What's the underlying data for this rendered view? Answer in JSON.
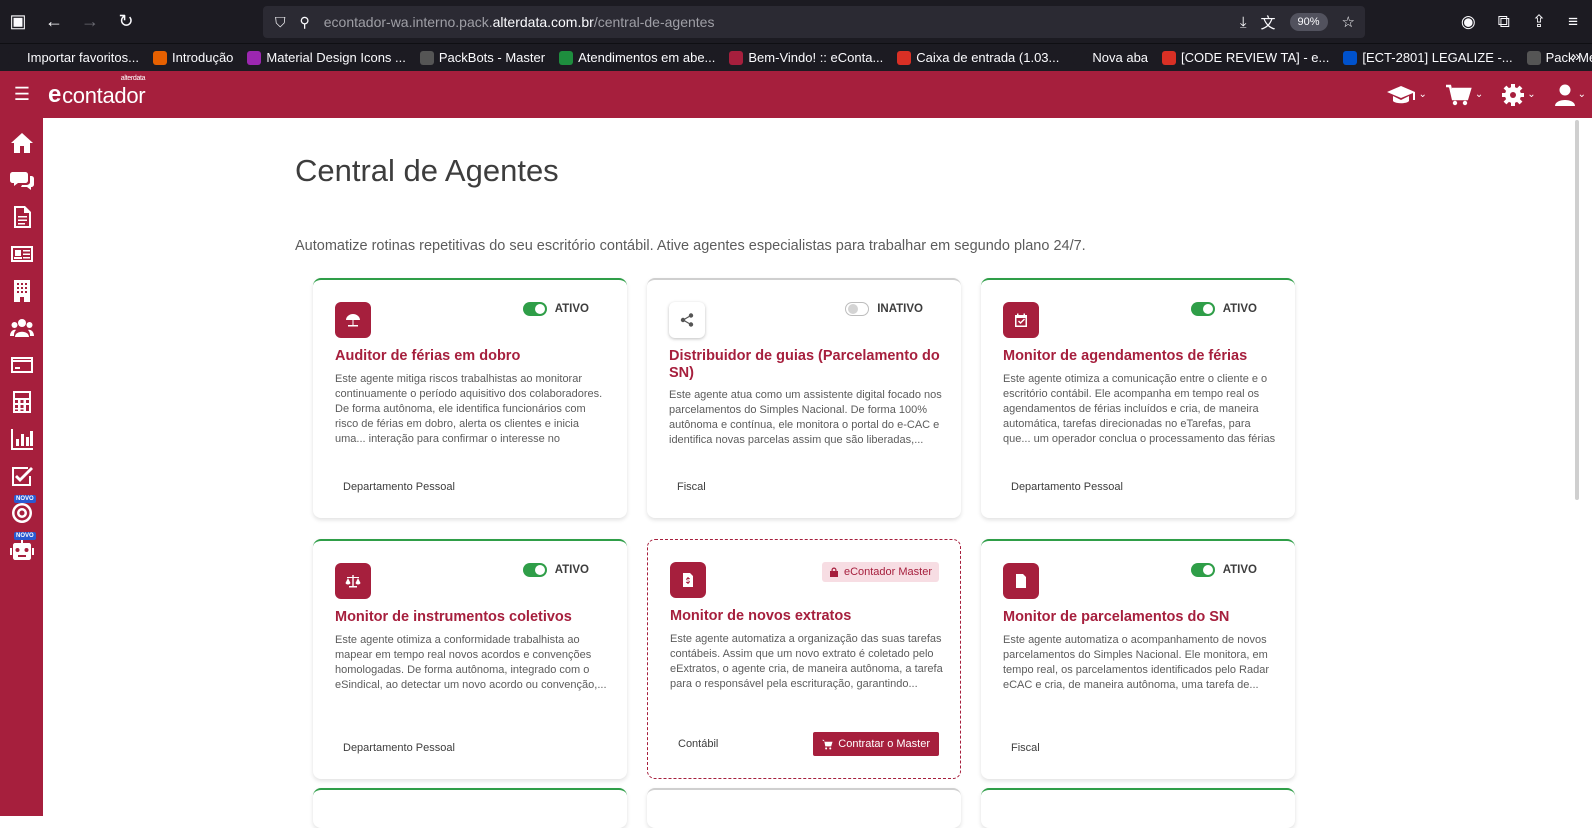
{
  "browser": {
    "url_prefix": "econtador-wa.interno.pack.",
    "url_domain": "alterdata.com.br",
    "url_path": "/central-de-agentes",
    "zoom": "90%"
  },
  "bookmarks": [
    {
      "label": "Importar favoritos...",
      "color": "#1c1b22"
    },
    {
      "label": "Introdução",
      "color": "#e66000"
    },
    {
      "label": "Material Design Icons ...",
      "color": "#9c27b0"
    },
    {
      "label": "PackBots - Master",
      "color": "#555555"
    },
    {
      "label": "Atendimentos em abe...",
      "color": "#1e8e3e"
    },
    {
      "label": "Bem-Vindo! :: eConta...",
      "color": "#a61f3d"
    },
    {
      "label": "Caixa de entrada (1.03...",
      "color": "#d93025"
    },
    {
      "label": "Nova aba",
      "color": "#1c1b22"
    },
    {
      "label": "[CODE REVIEW TA] - e...",
      "color": "#d93025"
    },
    {
      "label": "[ECT-2801] LEGALIZE -...",
      "color": "#0052cc"
    },
    {
      "label": "Pack Mensageiro",
      "color": "#555555"
    }
  ],
  "app": {
    "logo_text": "contador",
    "logo_brand": "alterdata",
    "accent": "#a61f3d"
  },
  "sidebar": {
    "novo_label": "NOVO"
  },
  "page": {
    "title": "Central de Agentes",
    "subtitle": "Automatize rotinas repetitivas do seu escritório contábil. Ative agentes especialistas para trabalhar em segundo plano 24/7."
  },
  "cards": [
    {
      "title": "Auditor de férias em dobro",
      "status": "ATIVO",
      "description": "Este agente mitiga riscos trabalhistas ao monitorar continuamente o período aquisitivo dos colaboradores. De forma autônoma, ele identifica funcionários com risco de férias em dobro, alerta os clientes e inicia uma... interação para confirmar o interesse no agendamento,",
      "tag": "Departamento Pessoal"
    },
    {
      "title": "Distribuidor de guias (Parcelamento do SN)",
      "status": "INATIVO",
      "description": "Este agente atua como um assistente digital focado nos parcelamentos do Simples Nacional. De forma 100% autônoma e contínua, ele monitora o portal do e-CAC e identifica novas parcelas assim que são liberadas,...",
      "tag": "Fiscal"
    },
    {
      "title": "Monitor de agendamentos de férias",
      "status": "ATIVO",
      "description": "Este agente otimiza a comunicação entre o cliente e o escritório contábil. Ele acompanha em tempo real os agendamentos de férias incluídos e cria, de maneira automática, tarefas direcionadas no eTarefas, para que... um operador conclua o processamento das férias do",
      "tag": "Departamento Pessoal"
    },
    {
      "title": "Monitor de instrumentos coletivos",
      "status": "ATIVO",
      "description": "Este agente otimiza a conformidade trabalhista ao mapear em tempo real novos acordos e convenções homologadas. De forma autônoma, integrado com o eSindical, ao detectar um novo acordo ou convenção,...",
      "tag": "Departamento Pessoal"
    },
    {
      "title": "Monitor de novos extratos",
      "badge": "eContador Master",
      "description": "Este agente automatiza a organização das suas tarefas contábeis. Assim que um novo extrato é coletado pelo eExtratos, o agente cria, de maneira autônoma, a tarefa para o responsável pela escrituração, garantindo...",
      "tag": "Contábil",
      "button": "Contratar o Master"
    },
    {
      "title": "Monitor de parcelamentos do SN",
      "status": "ATIVO",
      "description": "Este agente automatiza o acompanhamento de novos parcelamentos do Simples Nacional. Ele monitora, em tempo real, os parcelamentos identificados pelo Radar eCAC e cria, de maneira autônoma, uma tarefa de...",
      "tag": "Fiscal"
    }
  ]
}
